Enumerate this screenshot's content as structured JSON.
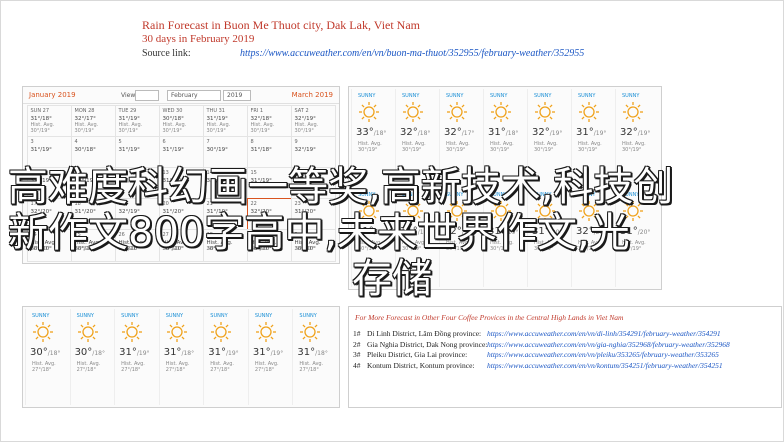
{
  "header": {
    "title": "Rain Forecast in Buon Me Thuot city, Dak Lak, Viet Nam",
    "subtitle": "30 days in February 2019",
    "source_label": "Source link:",
    "source_url": "https://www.accuweather.com/en/vn/buon-ma-thuot/352955/february-weather/352955"
  },
  "calendar": {
    "left_month": "January 2019",
    "right_month": "March 2019",
    "view_label": "View",
    "month_select": "February",
    "year_select": "2019",
    "cells": [
      {
        "d": "SUN 27",
        "t": "31°/18°",
        "r": "Hist. Avg. 30°/19°"
      },
      {
        "d": "MON 28",
        "t": "32°/17°",
        "r": "Hist. Avg. 30°/19°"
      },
      {
        "d": "TUE 29",
        "t": "31°/19°",
        "r": "Hist. Avg. 30°/19°"
      },
      {
        "d": "WED 30",
        "t": "30°/18°",
        "r": "Hist. Avg. 30°/19°"
      },
      {
        "d": "THU 31",
        "t": "31°/19°",
        "r": "Hist. Avg. 30°/19°"
      },
      {
        "d": "FRI 1",
        "t": "32°/18°",
        "r": "Hist. Avg. 30°/19°"
      },
      {
        "d": "SAT 2",
        "t": "32°/19°",
        "r": "Hist. Avg. 30°/19°"
      },
      {
        "d": "3",
        "t": "31°/19°",
        "r": ""
      },
      {
        "d": "4",
        "t": "30°/18°",
        "r": ""
      },
      {
        "d": "5",
        "t": "31°/19°",
        "r": ""
      },
      {
        "d": "6",
        "t": "31°/19°",
        "r": ""
      },
      {
        "d": "7",
        "t": "30°/19°",
        "r": ""
      },
      {
        "d": "8",
        "t": "31°/18°",
        "r": ""
      },
      {
        "d": "9",
        "t": "32°/19°",
        "r": ""
      },
      {
        "d": "10",
        "t": "31°/19°",
        "r": ""
      },
      {
        "d": "11",
        "t": "31°/19°",
        "r": ""
      },
      {
        "d": "12",
        "t": "30°/19°",
        "r": ""
      },
      {
        "d": "13",
        "t": "31°/20°",
        "r": ""
      },
      {
        "d": "14",
        "t": "32°/19°",
        "r": ""
      },
      {
        "d": "15",
        "t": "31°/19°",
        "r": ""
      },
      {
        "d": "16",
        "t": "31°/19°",
        "r": ""
      },
      {
        "d": "17",
        "t": "32°/20°",
        "r": ""
      },
      {
        "d": "18",
        "t": "31°/20°",
        "r": ""
      },
      {
        "d": "19",
        "t": "32°/19°",
        "r": ""
      },
      {
        "d": "20",
        "t": "31°/20°",
        "r": ""
      },
      {
        "d": "21",
        "t": "31°/19°",
        "r": ""
      },
      {
        "d": "22",
        "t": "32°/20°",
        "r": ""
      },
      {
        "d": "23",
        "t": "31°/20°",
        "r": ""
      },
      {
        "d": "24",
        "t": "Hist. Avg. 30°/20°",
        "r": "28°/20°"
      },
      {
        "d": "25",
        "t": "Hist. Avg. 30°/20°",
        "r": "28°/20°"
      },
      {
        "d": "26",
        "t": "Hist. Avg. 30°/20°",
        "r": "28°/20°"
      },
      {
        "d": "27",
        "t": "Hist. Avg. 30°/20°",
        "r": "28°/20°"
      },
      {
        "d": "28",
        "t": "Hist. Avg. 30°/20°",
        "r": "28°/20°"
      },
      {
        "d": "1",
        "t": "Hist. Avg. 30°/20°",
        "r": "28°/20°"
      },
      {
        "d": "2",
        "t": "Hist. Avg. 30°/20°",
        "r": "28°/20°"
      }
    ]
  },
  "forecast_top": [
    {
      "day": "SUNNY",
      "temp": "33°",
      "low": "/18°",
      "desc": "Hist. Avg. 30°/19°"
    },
    {
      "day": "SUNNY",
      "temp": "32°",
      "low": "/18°",
      "desc": "Hist. Avg. 30°/19°"
    },
    {
      "day": "SUNNY",
      "temp": "32°",
      "low": "/17°",
      "desc": "Hist. Avg. 30°/19°"
    },
    {
      "day": "SUNNY",
      "temp": "31°",
      "low": "/18°",
      "desc": "Hist. Avg. 30°/19°"
    },
    {
      "day": "SUNNY",
      "temp": "32°",
      "low": "/19°",
      "desc": "Hist. Avg. 30°/19°"
    },
    {
      "day": "SUNNY",
      "temp": "31°",
      "low": "/19°",
      "desc": "Hist. Avg. 30°/19°"
    },
    {
      "day": "SUNNY",
      "temp": "32°",
      "low": "/19°",
      "desc": "Hist. Avg. 30°/19°"
    },
    {
      "day": "SUNNY",
      "temp": "31°",
      "low": "/19°",
      "desc": "Hist. Avg. 30°/19°"
    },
    {
      "day": "SUNNY",
      "temp": "31°",
      "low": "/19°",
      "desc": "Hist. Avg. 30°/19°"
    },
    {
      "day": "SUNNY",
      "temp": "32°",
      "low": "/19°",
      "desc": "Hist. Avg. 30°/19°"
    },
    {
      "day": "SUNNY",
      "temp": "31°",
      "low": "/19°",
      "desc": "Hist. Avg. 30°/19°"
    },
    {
      "day": "SUNNY",
      "temp": "31°",
      "low": "/20°",
      "desc": "Hist. Avg. 30°/19°"
    },
    {
      "day": "SUNNY",
      "temp": "32°",
      "low": "/20°",
      "desc": "Hist. Avg. 30°/19°"
    },
    {
      "day": "SUNNY",
      "temp": "31°",
      "low": "/20°",
      "desc": "Hist. Avg. 30°/19°"
    }
  ],
  "forecast_bottom": [
    {
      "day": "SUNNY",
      "temp": "30°",
      "low": "/18°",
      "desc": "Hist. Avg. 27°/18°"
    },
    {
      "day": "SUNNY",
      "temp": "30°",
      "low": "/18°",
      "desc": "Hist. Avg. 27°/18°"
    },
    {
      "day": "SUNNY",
      "temp": "31°",
      "low": "/19°",
      "desc": "Hist. Avg. 27°/18°"
    },
    {
      "day": "SUNNY",
      "temp": "31°",
      "low": "/18°",
      "desc": "Hist. Avg. 27°/18°"
    },
    {
      "day": "SUNNY",
      "temp": "31°",
      "low": "/19°",
      "desc": "Hist. Avg. 27°/18°"
    },
    {
      "day": "SUNNY",
      "temp": "31°",
      "low": "/19°",
      "desc": "Hist. Avg. 27°/18°"
    },
    {
      "day": "SUNNY",
      "temp": "31°",
      "low": "/18°",
      "desc": "Hist. Avg. 27°/18°"
    }
  ],
  "more": {
    "title": "For More Forecast in Other Four Coffee Provices in the Central High Lands in Viet Nam",
    "rows": [
      {
        "n": "1#",
        "name": "Di Linh District, Lâm Đồng province:",
        "url": "https://www.accuweather.com/en/vn/di-linh/354291/february-weather/354291"
      },
      {
        "n": "2#",
        "name": "Gia Nghia District, Dak Nong province:",
        "url": "https://www.accuweather.com/en/vn/gia-nghia/352968/february-weather/352968"
      },
      {
        "n": "3#",
        "name": "Pleiku District, Gia Lai province:",
        "url": "https://www.accuweather.com/en/vn/pleiku/353265/february-weather/353265"
      },
      {
        "n": "4#",
        "name": "Kontum District, Kontum province:",
        "url": "https://www.accuweather.com/en/vn/kontum/354251/february-weather/354251"
      }
    ]
  },
  "overlay": {
    "line1": "高难度科幻画一等奖,高新技术,科技创",
    "line2": "新作文800字高中,未来世界作文,光",
    "line3": "存储"
  }
}
